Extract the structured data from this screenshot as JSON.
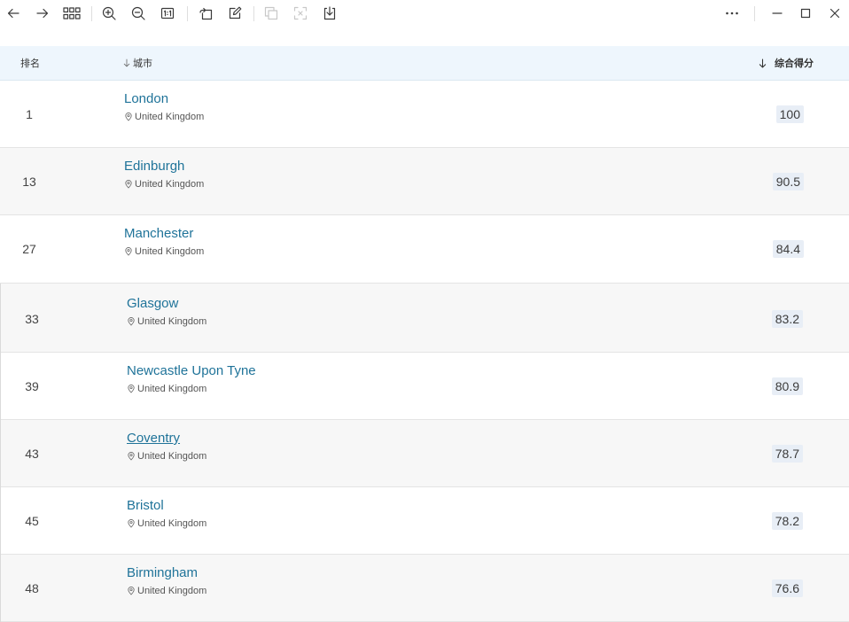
{
  "colors": {
    "link": "#1f7399",
    "header_bg": "#eef6fd",
    "stripe_bg": "#f7f7f7",
    "badge_bg": "#e8eef6",
    "border": "#e4e4e4",
    "text": "#333333",
    "muted": "#555555",
    "disabled_icon": "#c8c8c8"
  },
  "toolbar": {
    "left": [
      {
        "icon": "back-arrow-icon",
        "enabled": true
      },
      {
        "icon": "forward-arrow-icon",
        "enabled": true
      },
      {
        "icon": "grid-view-icon",
        "enabled": true
      },
      {
        "icon": "zoom-in-icon",
        "enabled": true
      },
      {
        "icon": "zoom-out-icon",
        "enabled": true
      },
      {
        "icon": "actual-size-icon",
        "enabled": true
      },
      {
        "icon": "rotate-icon",
        "enabled": true
      },
      {
        "icon": "edit-icon",
        "enabled": true
      },
      {
        "icon": "copy-icon",
        "enabled": false
      },
      {
        "icon": "scan-text-icon",
        "enabled": false
      },
      {
        "icon": "save-icon",
        "enabled": true
      }
    ],
    "right": [
      {
        "icon": "more-icon"
      },
      {
        "icon": "minimize-icon"
      },
      {
        "icon": "maximize-icon"
      },
      {
        "icon": "close-icon"
      }
    ]
  },
  "table": {
    "headers": {
      "rank": "排名",
      "city": "城市",
      "score": "综合得分"
    },
    "sort": {
      "city": "descending",
      "score": "descending"
    },
    "rows": [
      {
        "rank": 1,
        "city": "London",
        "country": "United Kingdom",
        "score": 100
      },
      {
        "rank": 13,
        "city": "Edinburgh",
        "country": "United Kingdom",
        "score": 90.5
      },
      {
        "rank": 27,
        "city": "Manchester",
        "country": "United Kingdom",
        "score": 84.4
      },
      {
        "rank": 33,
        "city": "Glasgow",
        "country": "United Kingdom",
        "score": 83.2
      },
      {
        "rank": 39,
        "city": "Newcastle Upon Tyne",
        "country": "United Kingdom",
        "score": 80.9
      },
      {
        "rank": 43,
        "city": "Coventry",
        "country": "United Kingdom",
        "score": 78.7
      },
      {
        "rank": 45,
        "city": "Bristol",
        "country": "United Kingdom",
        "score": 78.2
      },
      {
        "rank": 48,
        "city": "Birmingham",
        "country": "United Kingdom",
        "score": 76.6
      }
    ]
  }
}
